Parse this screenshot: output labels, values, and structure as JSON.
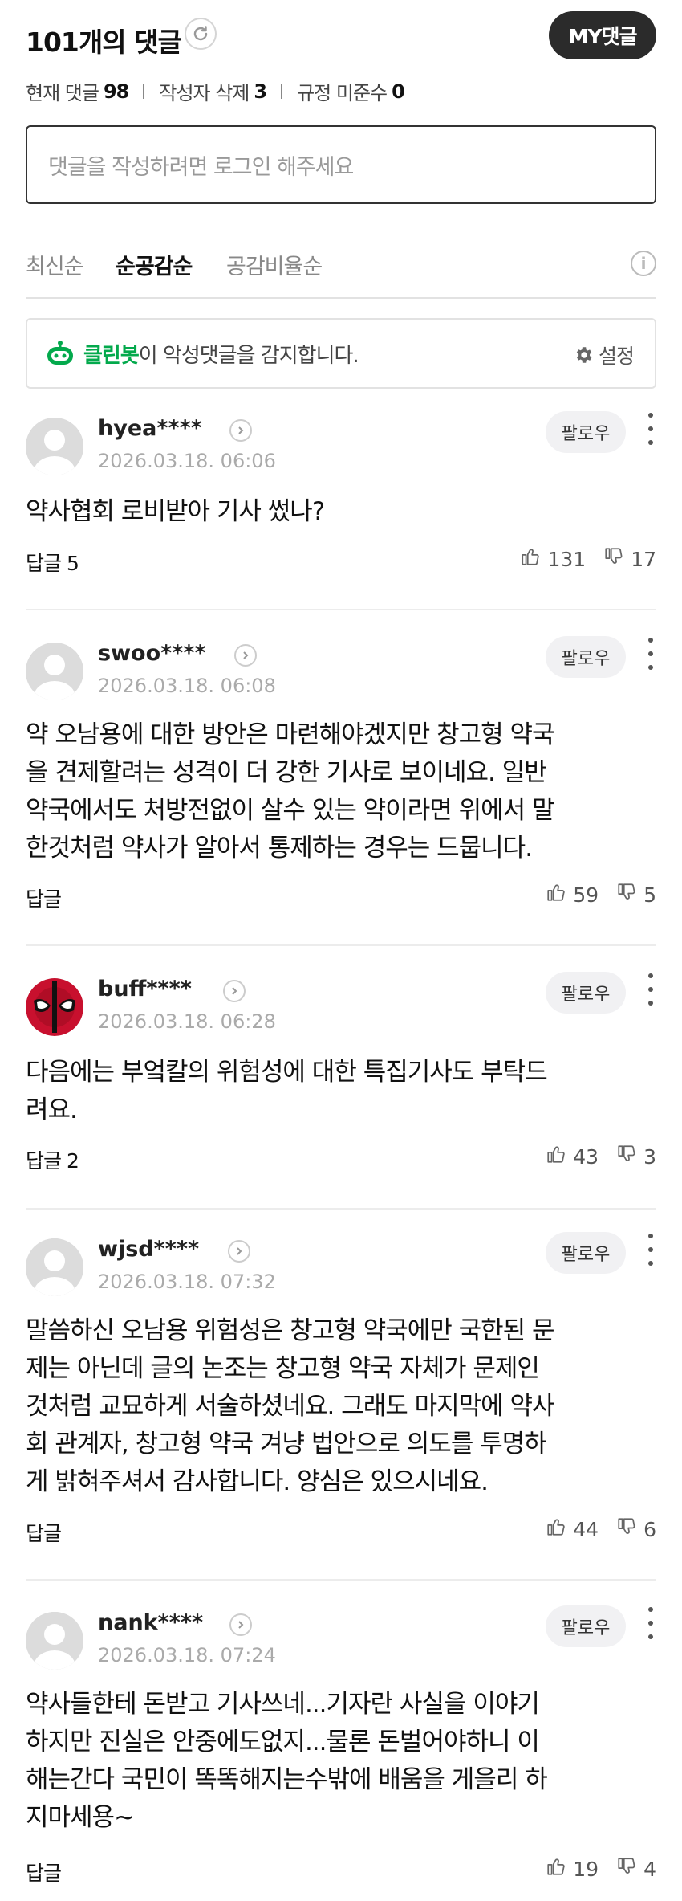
{
  "header": {
    "title": "101개의 댓글",
    "my_button": "MY댓글"
  },
  "stats": {
    "current_label": "현재 댓글",
    "current_count": "98",
    "deleted_label": "작성자 삭제",
    "deleted_count": "3",
    "violation_label": "규정 미준수",
    "violation_count": "0"
  },
  "comment_input": {
    "placeholder": "댓글을 작성하려면 로그인 해주세요"
  },
  "sort": {
    "options": [
      "최신순",
      "순공감순",
      "공감비율순"
    ],
    "active": "순공감순"
  },
  "cleanbot": {
    "name": "클린봇",
    "message": "이 악성댓글을 감지합니다.",
    "settings_label": "설정"
  },
  "follow_label": "팔로우",
  "comments": [
    {
      "username": "hyea****",
      "date": "2026.03.18. 06:06",
      "lines": [
        "약사협회 로비받아 기사 썼나?"
      ],
      "reply": "답글 5",
      "likes": "131",
      "dislikes": "17",
      "avatar": "default"
    },
    {
      "username": "swoo****",
      "date": "2026.03.18. 06:08",
      "lines": [
        "약 오남용에 대한 방안은 마련해야겠지만 창고형 약국",
        "을 견제할려는 성격이 더 강한 기사로 보이네요. 일반",
        "약국에서도 처방전없이 살수 있는 약이라면 위에서 말",
        "한것처럼 약사가 알아서 통제하는 경우는 드뭅니다."
      ],
      "reply": "답글",
      "likes": "59",
      "dislikes": "5",
      "avatar": "default"
    },
    {
      "username": "buff****",
      "date": "2026.03.18. 06:28",
      "lines": [
        "다음에는 부엌칼의 위험성에 대한 특집기사도 부탁드",
        "려요."
      ],
      "reply": "답글 2",
      "likes": "43",
      "dislikes": "3",
      "avatar": "mask"
    },
    {
      "username": "wjsd****",
      "date": "2026.03.18. 07:32",
      "lines": [
        "말씀하신 오남용 위험성은 창고형 약국에만 국한된 문",
        "제는 아닌데 글의 논조는 창고형 약국 자체가 문제인",
        "것처럼 교묘하게 서술하셨네요. 그래도 마지막에 약사",
        "회 관계자, 창고형 약국 겨냥 법안으로 의도를 투명하",
        "게 밝혀주셔서 감사합니다. 양심은 있으시네요."
      ],
      "reply": "답글",
      "likes": "44",
      "dislikes": "6",
      "avatar": "default"
    },
    {
      "username": "nank****",
      "date": "2026.03.18. 07:24",
      "lines": [
        "약사들한테 돈받고 기사쓰네...기자란 사실을 이야기",
        "하지만 진실은 안중에도없지...물론 돈벌어야하니 이",
        "해는간다 국민이 똑똑해지는수밖에 배움을 게을리 하",
        "지마세용~"
      ],
      "reply": "답글",
      "likes": "19",
      "dislikes": "4",
      "avatar": "default"
    }
  ]
}
